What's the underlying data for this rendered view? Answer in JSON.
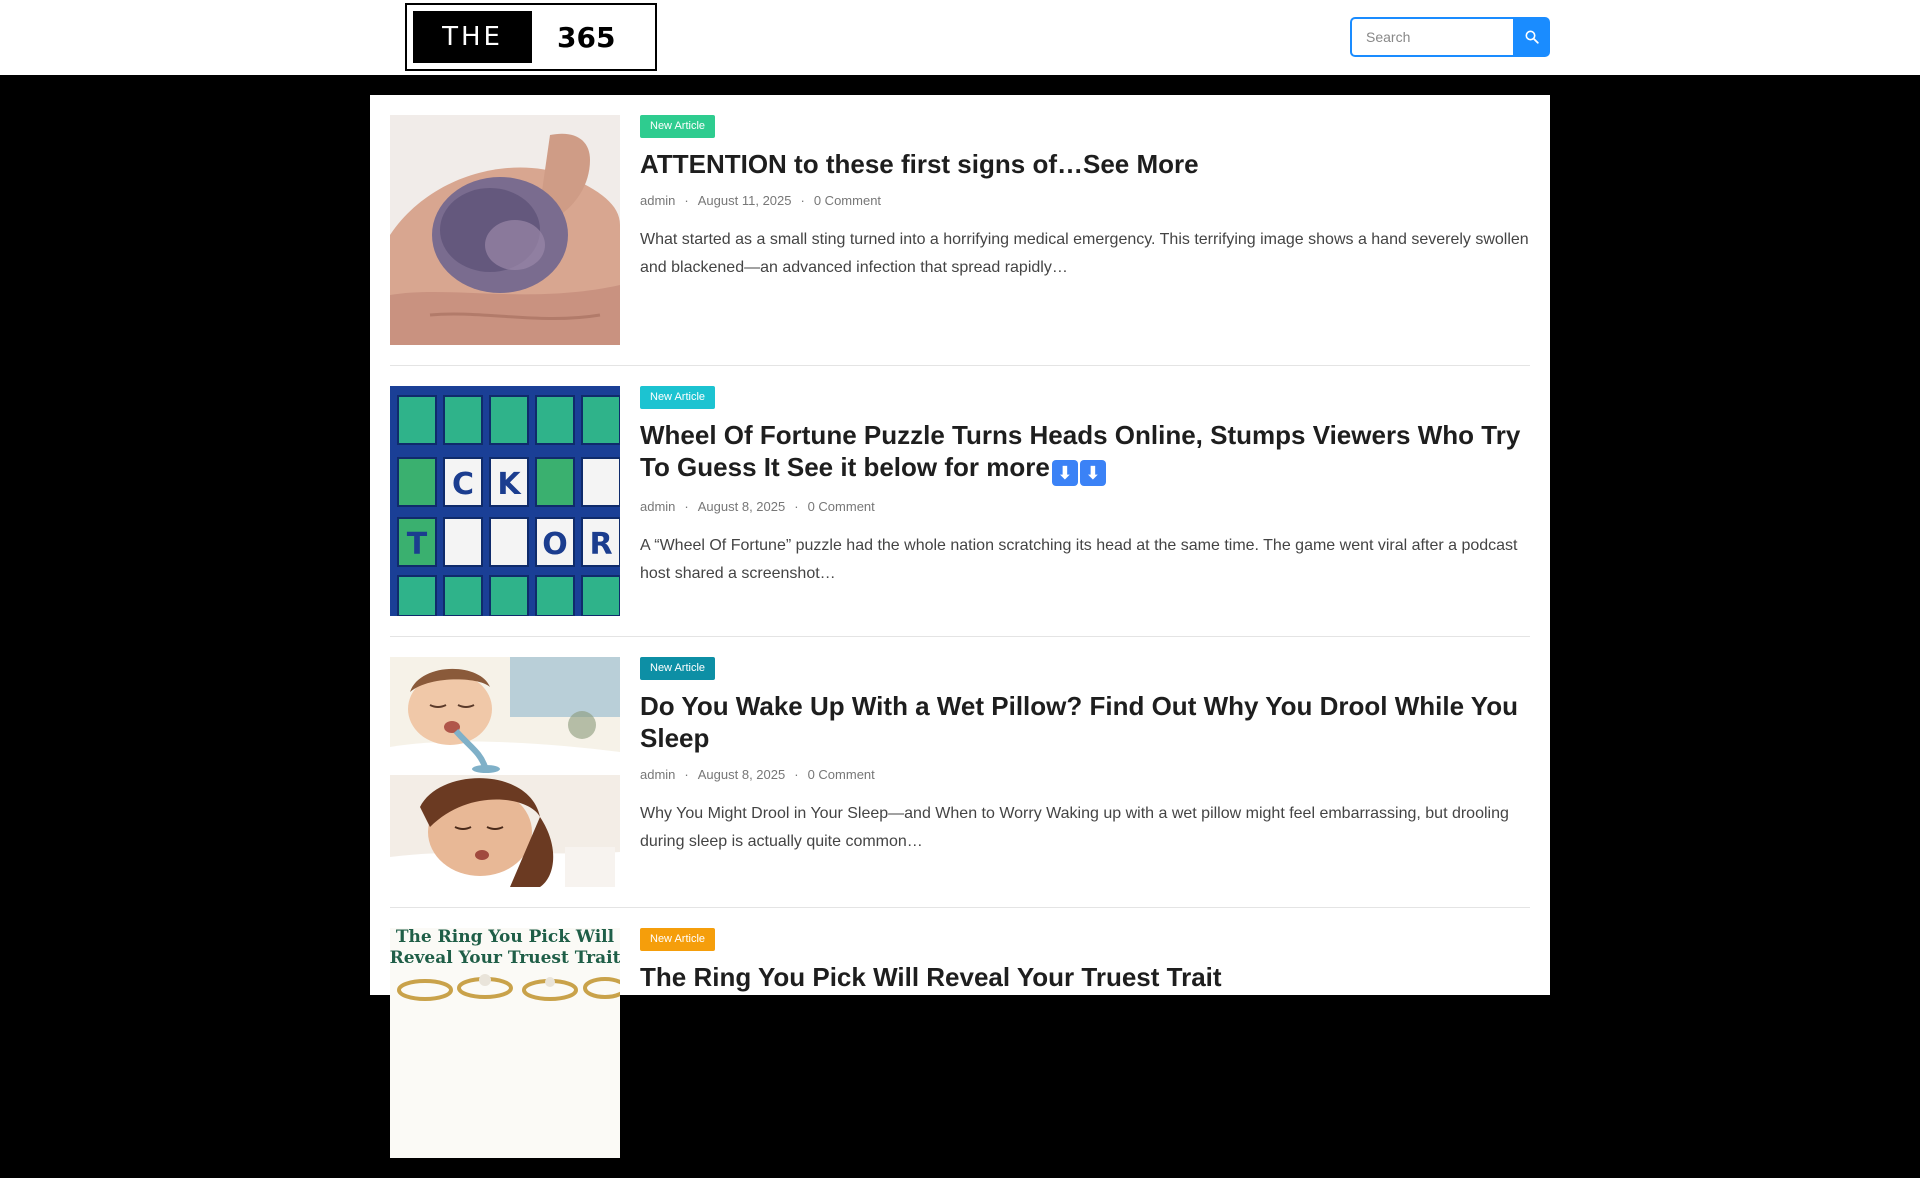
{
  "header": {
    "logo_left": "THE",
    "logo_right": "365",
    "search_placeholder": "Search"
  },
  "articles": [
    {
      "badge": "New Article",
      "badge_color": "#2ecc8f",
      "title": "ATTENTION to these first signs of…See More",
      "author": "admin",
      "date": "August 11, 2025",
      "comments": "0 Comment",
      "excerpt": "What started as a small sting turned into a horrifying medical emergency. This terrifying image shows a hand severely swollen and blackened—an advanced infection that spread rapidly…"
    },
    {
      "badge": "New Article",
      "badge_color": "#1cc3d1",
      "title": "Wheel Of Fortune Puzzle Turns Heads Online, Stumps Viewers Who Try To Guess It See it below for more",
      "title_emoji": "⬇",
      "author": "admin",
      "date": "August 8, 2025",
      "comments": "0 Comment",
      "excerpt": "A “Wheel Of Fortune” puzzle had the whole nation scratching its head at the same time. The game went viral after a podcast host shared a screenshot…",
      "thumb_letters": [
        "C",
        "K",
        "T",
        "O",
        "R"
      ]
    },
    {
      "badge": "New Article",
      "badge_color": "#0d8fa5",
      "title": "Do You Wake Up With a Wet Pillow? Find Out Why You Drool While You Sleep",
      "author": "admin",
      "date": "August 8, 2025",
      "comments": "0 Comment",
      "excerpt": "Why You Might Drool in Your Sleep—and When to Worry Waking up with a wet pillow might feel embarrassing, but drooling during sleep is actually quite common…"
    },
    {
      "badge": "New Article",
      "badge_color": "#f59e0b",
      "title": "The Ring You Pick Will Reveal Your Truest Trait",
      "thumb_text_1": "The Ring You Pick Will",
      "thumb_text_2": "Reveal Your Truest Trait"
    }
  ]
}
